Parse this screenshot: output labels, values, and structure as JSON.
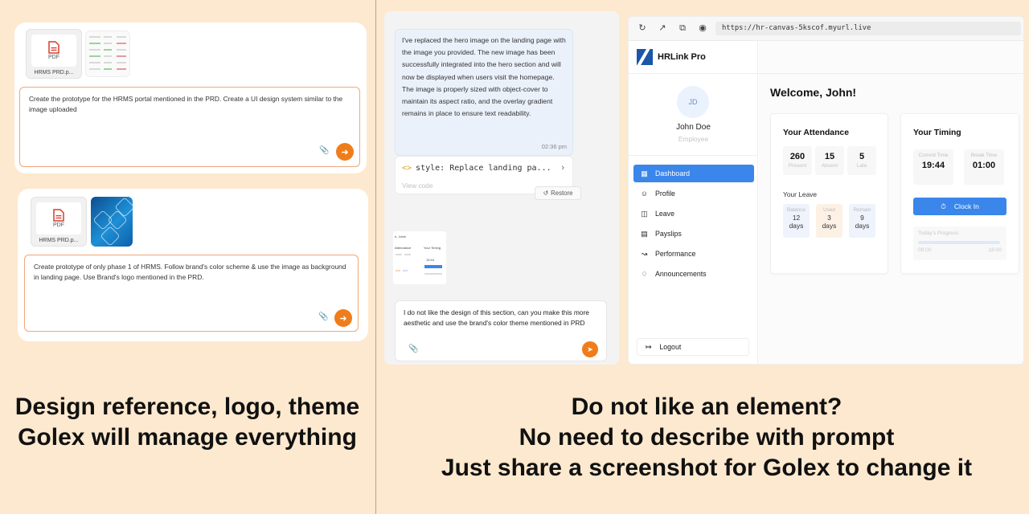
{
  "left": {
    "card1": {
      "pdf_badge": "PDF",
      "pdf_name": "HRMS PRD.p...",
      "prompt": "Create the prototype for the HRMS portal mentioned in the PRD. Create a UI design system similar to the image uploaded"
    },
    "card2": {
      "pdf_badge": "PDF",
      "pdf_name": "HRMS PRD.p...",
      "prompt": "Create prototype of only phase 1 of HRMS. Follow brand's color scheme & use the image as background in landing page. Use Brand's logo mentioned in the PRD."
    },
    "caption_line1": "Design reference, logo, theme",
    "caption_line2": "Golex will manage everything"
  },
  "chat": {
    "message": "I've replaced the hero image on the landing page with the image you provided. The new image has been successfully integrated into the hero section and will now be displayed when users visit the homepage. The image is properly sized with object-cover to maintain its aspect ratio, and the overlay gradient remains in place to ensure text readability.",
    "time": "02:36 pm",
    "code_label": "style: Replace landing pa...",
    "view_code": "View code",
    "restore": "Restore",
    "mini": {
      "welcome": "e, John!",
      "attendance": "Attendance",
      "timing": "Your Timing",
      "time": "19:44"
    },
    "input": "I do not like the design of this section, can you make this more aesthetic and use the brand's color theme mentioned in PRD"
  },
  "app": {
    "url": "https://hr-canvas-5kscof.myurl.live",
    "brand": "HRLink Pro",
    "avatar": "JD",
    "user_name": "John Doe",
    "user_role": "Employee",
    "nav": [
      {
        "label": "Dashboard",
        "icon": "dashboard-icon"
      },
      {
        "label": "Profile",
        "icon": "user-icon"
      },
      {
        "label": "Leave",
        "icon": "calendar-icon"
      },
      {
        "label": "Payslips",
        "icon": "document-icon"
      },
      {
        "label": "Performance",
        "icon": "chart-icon"
      },
      {
        "label": "Announcements",
        "icon": "bell-icon"
      }
    ],
    "logout": "Logout",
    "welcome": "Welcome, John!",
    "attendance": {
      "title": "Your Attendance",
      "stats": [
        {
          "value": "260",
          "label": "Present"
        },
        {
          "value": "15",
          "label": "Absent"
        },
        {
          "value": "5",
          "label": "Late"
        }
      ],
      "leave_title": "Your Leave",
      "leave": [
        {
          "label": "Balance",
          "value": "12",
          "unit": "days",
          "color": "#eef3fc"
        },
        {
          "label": "Used",
          "value": "3",
          "unit": "days",
          "color": "#fdf1e6"
        },
        {
          "label": "Remain",
          "value": "9",
          "unit": "days",
          "color": "#eef3fc"
        }
      ]
    },
    "timing": {
      "title": "Your Timing",
      "current_label": "Current Time",
      "current_value": "19:44",
      "break_label": "Break Time",
      "break_value": "01:00",
      "clock_in": "Clock In",
      "progress_label": "Today's Progress",
      "progress_fraction": 0.0,
      "progress_start": "09:00",
      "progress_end": "18:00"
    }
  },
  "right_caption": {
    "line1": "Do not like an element?",
    "line2": "No need to describe with prompt",
    "line3": "Just share a screenshot for Golex to change it"
  },
  "colors": {
    "accent_orange": "#f07d1a",
    "app_blue": "#3a86ea",
    "pdf_red": "#d93a2b"
  }
}
